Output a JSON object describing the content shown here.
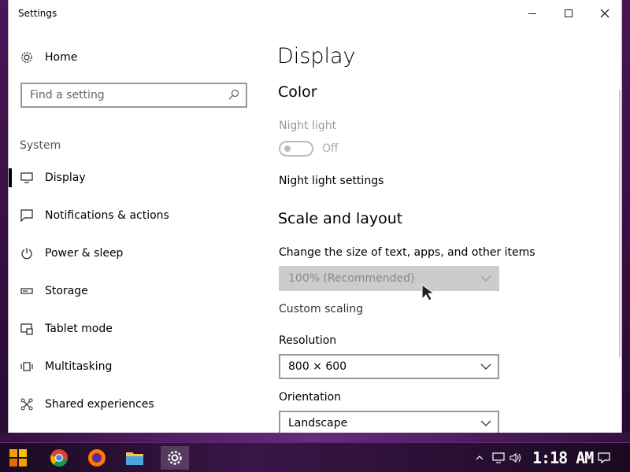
{
  "window": {
    "title": "Settings",
    "minimize_icon": "minimize-icon",
    "maximize_icon": "maximize-icon",
    "close_icon": "close-icon"
  },
  "nav": {
    "home_label": "Home",
    "search_placeholder": "Find a setting",
    "section": "System",
    "items": [
      {
        "label": "Display",
        "icon": "monitor-icon",
        "active": true
      },
      {
        "label": "Notifications & actions",
        "icon": "message-icon",
        "active": false
      },
      {
        "label": "Power & sleep",
        "icon": "power-icon",
        "active": false
      },
      {
        "label": "Storage",
        "icon": "storage-icon",
        "active": false
      },
      {
        "label": "Tablet mode",
        "icon": "tablet-icon",
        "active": false
      },
      {
        "label": "Multitasking",
        "icon": "multitasking-icon",
        "active": false
      },
      {
        "label": "Shared experiences",
        "icon": "shared-icon",
        "active": false
      }
    ]
  },
  "content": {
    "title": "Display",
    "color_heading": "Color",
    "night_light_label": "Night light",
    "night_light_state": "Off",
    "night_light_settings_link": "Night light settings",
    "scale_heading": "Scale and layout",
    "scale_label": "Change the size of text, apps, and other items",
    "scale_value": "100% (Recommended)",
    "custom_scaling_link": "Custom scaling",
    "resolution_label": "Resolution",
    "resolution_value": "800 × 600",
    "orientation_label": "Orientation",
    "orientation_value": "Landscape"
  },
  "taskbar": {
    "clock": "1:18 AM",
    "apps": [
      "start-icon",
      "chrome-icon",
      "firefox-icon",
      "file-explorer-icon",
      "settings-icon"
    ]
  },
  "colors": {
    "window_bg": "#ffffff",
    "disabled_dropdown": "#cccccc",
    "taskbar_bg": "#2a0d35"
  }
}
